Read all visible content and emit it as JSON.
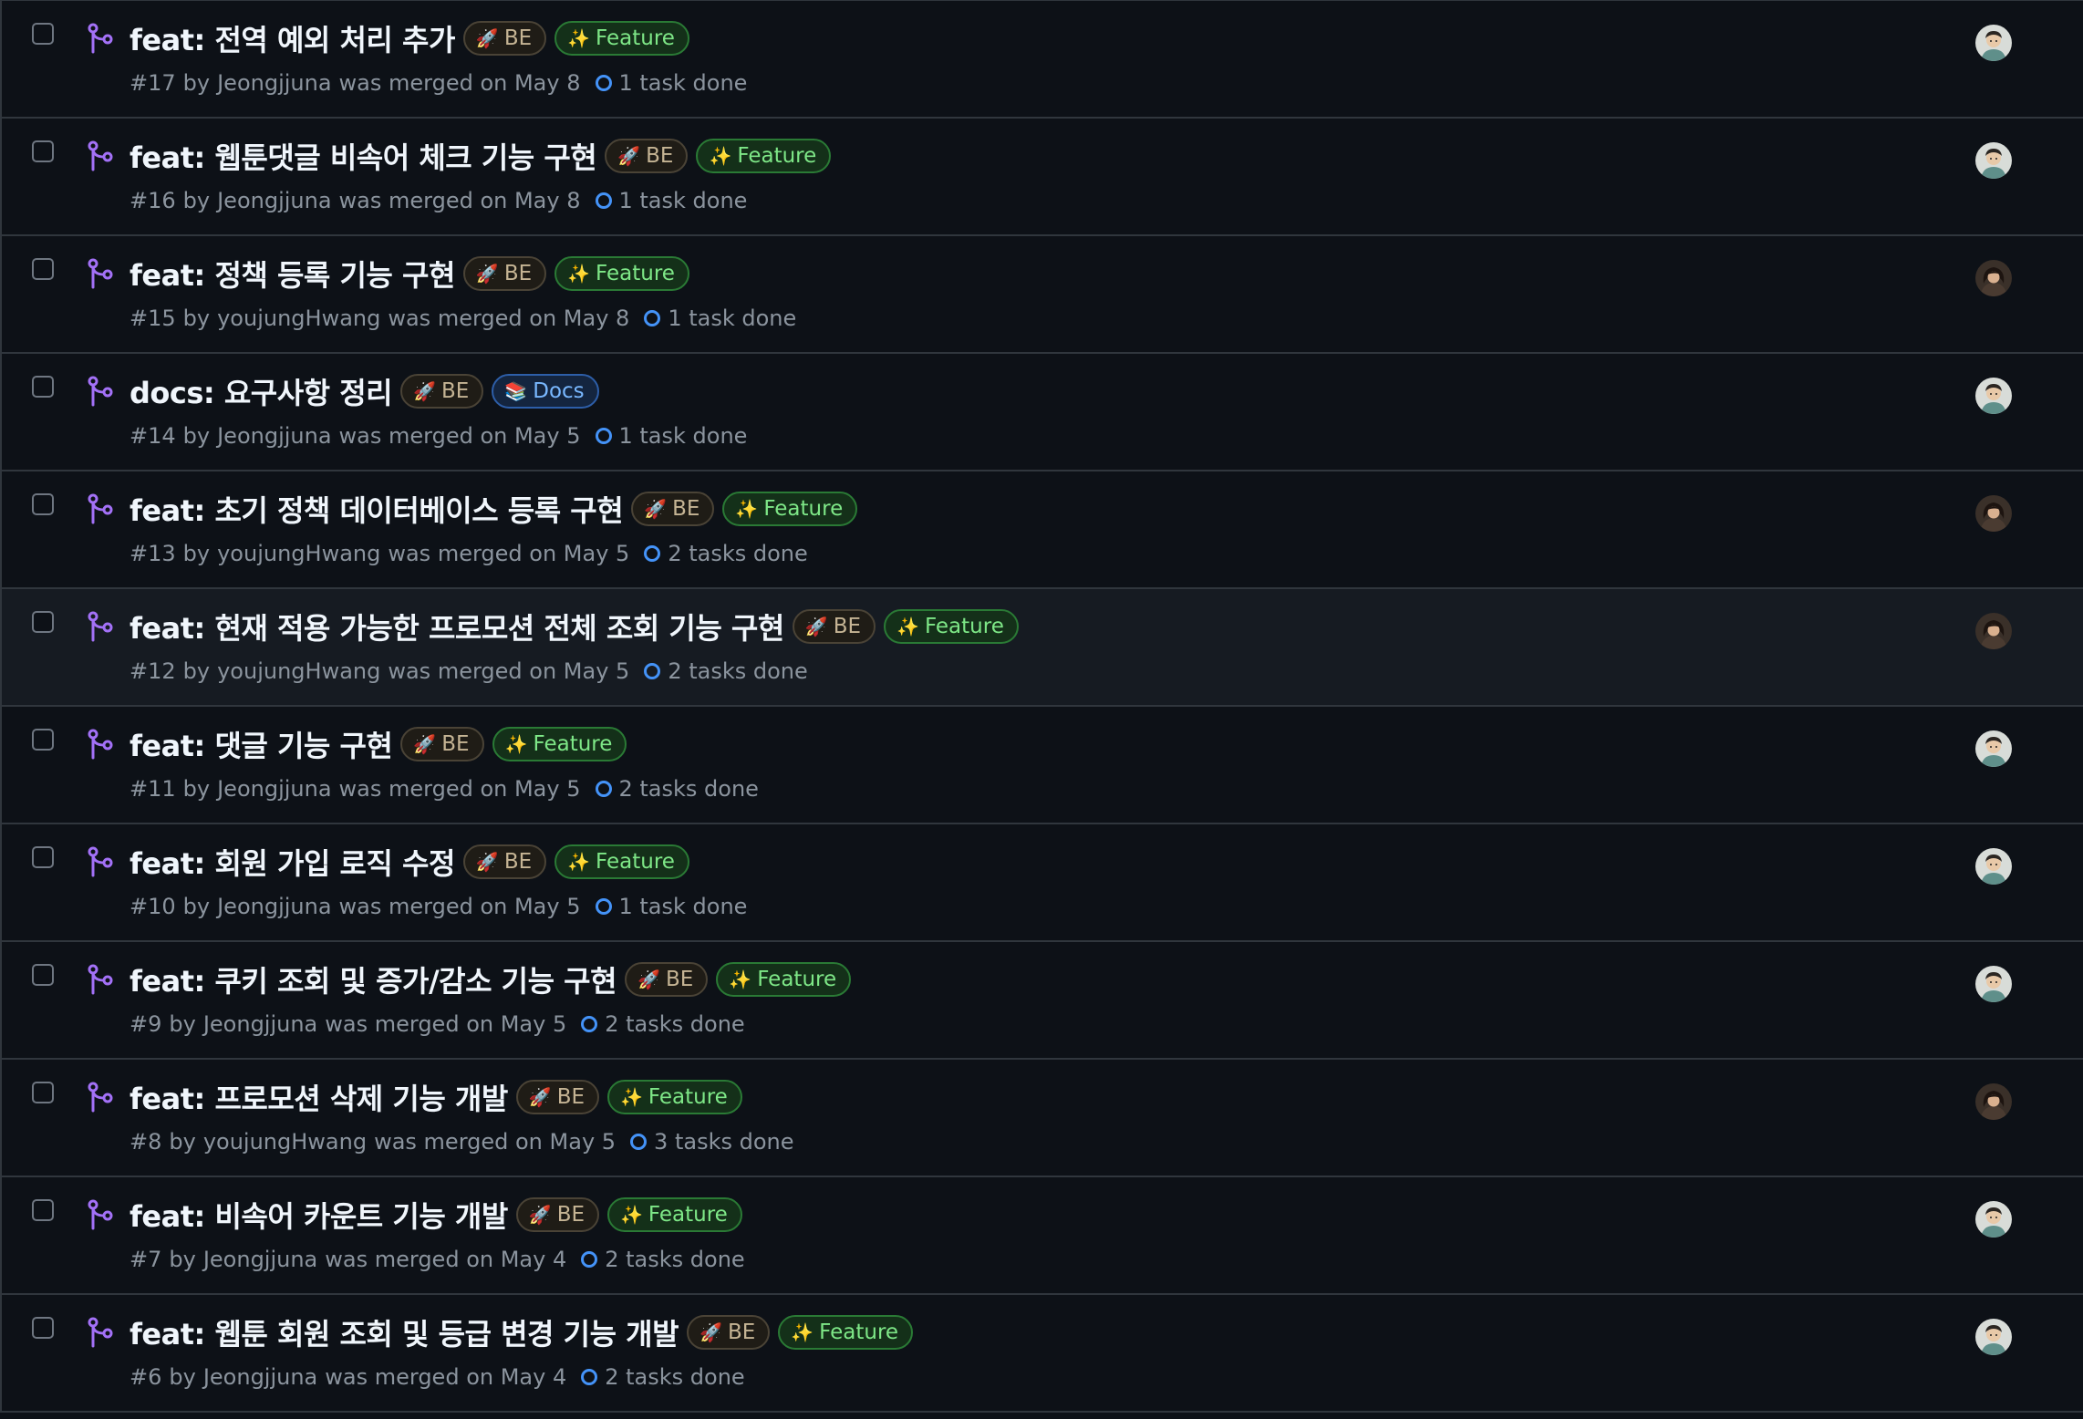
{
  "pull_requests": [
    {
      "title": "feat: 전역 예외 처리 추가",
      "labels": [
        {
          "kind": "be",
          "emoji": "🚀",
          "text": "BE"
        },
        {
          "kind": "feature",
          "emoji": "✨",
          "text": "Feature"
        }
      ],
      "number": "#17",
      "by": "by",
      "author": "Jeongjjuna",
      "merged": "was merged on May 8",
      "tasks": "1 task done",
      "avatar": "avatar-a"
    },
    {
      "title": "feat: 웹툰댓글 비속어 체크 기능 구현",
      "labels": [
        {
          "kind": "be",
          "emoji": "🚀",
          "text": "BE"
        },
        {
          "kind": "feature",
          "emoji": "✨",
          "text": "Feature"
        }
      ],
      "number": "#16",
      "by": "by",
      "author": "Jeongjjuna",
      "merged": "was merged on May 8",
      "tasks": "1 task done",
      "avatar": "avatar-a"
    },
    {
      "title": "feat: 정책 등록 기능 구현",
      "labels": [
        {
          "kind": "be",
          "emoji": "🚀",
          "text": "BE"
        },
        {
          "kind": "feature",
          "emoji": "✨",
          "text": "Feature"
        }
      ],
      "number": "#15",
      "by": "by",
      "author": "youjungHwang",
      "merged": "was merged on May 8",
      "tasks": "1 task done",
      "avatar": "avatar-b"
    },
    {
      "title": "docs: 요구사항 정리",
      "labels": [
        {
          "kind": "be",
          "emoji": "🚀",
          "text": "BE"
        },
        {
          "kind": "docs",
          "emoji": "📚",
          "text": "Docs"
        }
      ],
      "number": "#14",
      "by": "by",
      "author": "Jeongjjuna",
      "merged": "was merged on May 5",
      "tasks": "1 task done",
      "avatar": "avatar-a"
    },
    {
      "title": "feat: 초기 정책 데이터베이스 등록 구현",
      "labels": [
        {
          "kind": "be",
          "emoji": "🚀",
          "text": "BE"
        },
        {
          "kind": "feature",
          "emoji": "✨",
          "text": "Feature"
        }
      ],
      "number": "#13",
      "by": "by",
      "author": "youjungHwang",
      "merged": "was merged on May 5",
      "tasks": "2 tasks done",
      "avatar": "avatar-b"
    },
    {
      "title": "feat: 현재 적용 가능한 프로모션 전체 조회 기능 구현",
      "labels": [
        {
          "kind": "be",
          "emoji": "🚀",
          "text": "BE"
        },
        {
          "kind": "feature",
          "emoji": "✨",
          "text": "Feature"
        }
      ],
      "number": "#12",
      "by": "by",
      "author": "youjungHwang",
      "merged": "was merged on May 5",
      "tasks": "2 tasks done",
      "avatar": "avatar-b",
      "hovered": true
    },
    {
      "title": "feat: 댓글 기능 구현",
      "labels": [
        {
          "kind": "be",
          "emoji": "🚀",
          "text": "BE"
        },
        {
          "kind": "feature",
          "emoji": "✨",
          "text": "Feature"
        }
      ],
      "number": "#11",
      "by": "by",
      "author": "Jeongjjuna",
      "merged": "was merged on May 5",
      "tasks": "2 tasks done",
      "avatar": "avatar-a"
    },
    {
      "title": "feat: 회원 가입 로직 수정",
      "labels": [
        {
          "kind": "be",
          "emoji": "🚀",
          "text": "BE"
        },
        {
          "kind": "feature",
          "emoji": "✨",
          "text": "Feature"
        }
      ],
      "number": "#10",
      "by": "by",
      "author": "Jeongjjuna",
      "merged": "was merged on May 5",
      "tasks": "1 task done",
      "avatar": "avatar-a"
    },
    {
      "title": "feat: 쿠키 조회 및 증가/감소 기능 구현",
      "labels": [
        {
          "kind": "be",
          "emoji": "🚀",
          "text": "BE"
        },
        {
          "kind": "feature",
          "emoji": "✨",
          "text": "Feature"
        }
      ],
      "number": "#9",
      "by": "by",
      "author": "Jeongjjuna",
      "merged": "was merged on May 5",
      "tasks": "2 tasks done",
      "avatar": "avatar-a"
    },
    {
      "title": "feat: 프로모션 삭제 기능 개발",
      "labels": [
        {
          "kind": "be",
          "emoji": "🚀",
          "text": "BE"
        },
        {
          "kind": "feature",
          "emoji": "✨",
          "text": "Feature"
        }
      ],
      "number": "#8",
      "by": "by",
      "author": "youjungHwang",
      "merged": "was merged on May 5",
      "tasks": "3 tasks done",
      "avatar": "avatar-b"
    },
    {
      "title": "feat: 비속어 카운트 기능 개발",
      "labels": [
        {
          "kind": "be",
          "emoji": "🚀",
          "text": "BE"
        },
        {
          "kind": "feature",
          "emoji": "✨",
          "text": "Feature"
        }
      ],
      "number": "#7",
      "by": "by",
      "author": "Jeongjjuna",
      "merged": "was merged on May 4",
      "tasks": "2 tasks done",
      "avatar": "avatar-a"
    },
    {
      "title": "feat: 웹툰 회원 조회 및 등급 변경 기능 개발",
      "labels": [
        {
          "kind": "be",
          "emoji": "🚀",
          "text": "BE"
        },
        {
          "kind": "feature",
          "emoji": "✨",
          "text": "Feature"
        }
      ],
      "number": "#6",
      "by": "by",
      "author": "Jeongjjuna",
      "merged": "was merged on May 4",
      "tasks": "2 tasks done",
      "avatar": "avatar-a"
    }
  ],
  "icons": {
    "merged": "git-merge-icon",
    "tasks": "task-progress-icon"
  },
  "colors": {
    "background": "#0d1117",
    "hover_background": "#161b22",
    "border": "#30363d",
    "merged_purple": "#a371f7",
    "muted_text": "#8b949e",
    "task_blue": "#4493f8",
    "feature_green": "#7ee787",
    "docs_blue": "#79b8ff",
    "be_tan": "#c5b494"
  }
}
